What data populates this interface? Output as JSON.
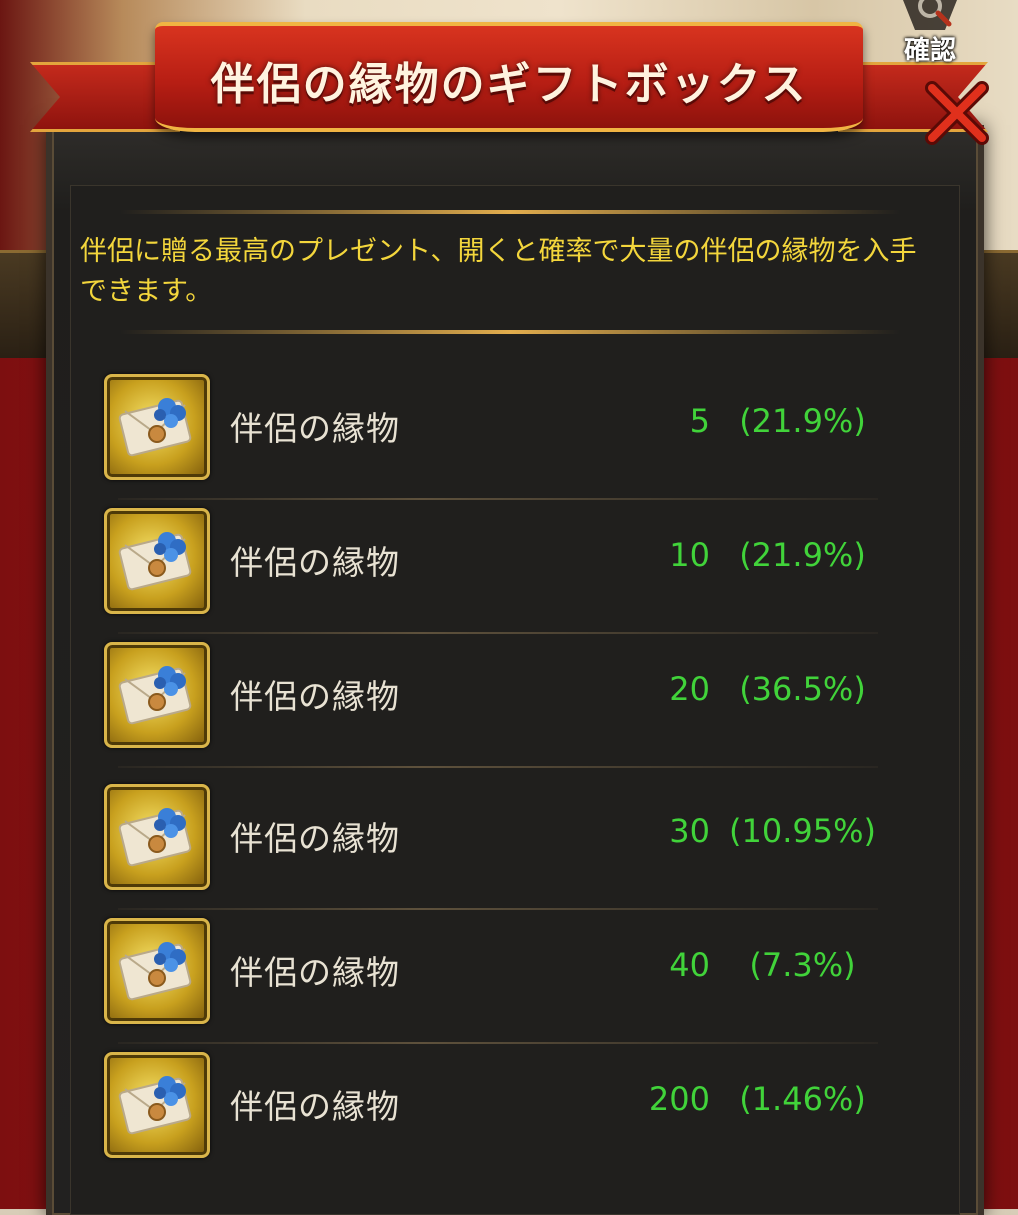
{
  "dialog": {
    "title": "伴侶の縁物のギフトボックス",
    "confirm_label": "確認",
    "description": "伴侶に贈る最高のプレゼント、開くと確率で大量の伴侶の縁物を入手できます。"
  },
  "items": [
    {
      "name": "伴侶の縁物",
      "quantity": "5",
      "probability": "(21.9%)"
    },
    {
      "name": "伴侶の縁物",
      "quantity": "10",
      "probability": "(21.9%)"
    },
    {
      "name": "伴侶の縁物",
      "quantity": "20",
      "probability": "(36.5%)"
    },
    {
      "name": "伴侶の縁物",
      "quantity": "30",
      "probability": "(10.95%)"
    },
    {
      "name": "伴侶の縁物",
      "quantity": "40",
      "probability": "(7.3%)"
    },
    {
      "name": "伴侶の縁物",
      "quantity": "200",
      "probability": "(1.46%)"
    }
  ],
  "colors": {
    "accent_gold": "#e2ad4d",
    "description_text": "#f3d63c",
    "value_green": "#41d33a",
    "ribbon_red": "#b71e14"
  },
  "icons": {
    "item": "letter-with-blue-flower-icon",
    "close": "close-x-icon",
    "confirm": "magnifier-icon"
  }
}
